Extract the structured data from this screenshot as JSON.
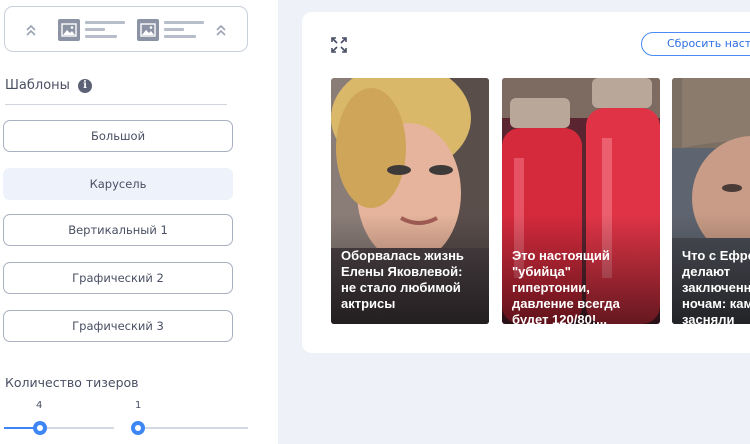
{
  "sidebar": {
    "section_title": "Шаблоны",
    "info_glyph": "i",
    "templates": [
      {
        "label": "Большой",
        "active": false
      },
      {
        "label": "Карусель",
        "active": true
      },
      {
        "label": "Вертикальный 1",
        "active": false
      },
      {
        "label": "Графический 2",
        "active": false
      },
      {
        "label": "Графический 3",
        "active": false
      }
    ],
    "teaser_count": {
      "title": "Количество тизеров",
      "sliders": [
        {
          "value": "4"
        },
        {
          "value": "1"
        }
      ]
    }
  },
  "preview": {
    "reset_label": "Сбросить настройки",
    "teasers": [
      {
        "caption": "Оборвалась жизнь\nЕлены Яковлевой:\nне стало любимой\nактрисы"
      },
      {
        "caption": "Это настоящий\n\"убийца\"\nгипертонии,\nдавление всегда\nбудет 120/80!..."
      },
      {
        "caption": "Что с Ефремовым\nделают\nзаключенные\nночам: камера\nзасняли"
      }
    ]
  },
  "colors": {
    "accent": "#3f86f5",
    "active_template_bg": "#eef2fa",
    "main_bg": "#eef1f8"
  },
  "icons": [
    "chevron-up-double-icon",
    "image-icon",
    "info-icon",
    "expand-icon"
  ]
}
